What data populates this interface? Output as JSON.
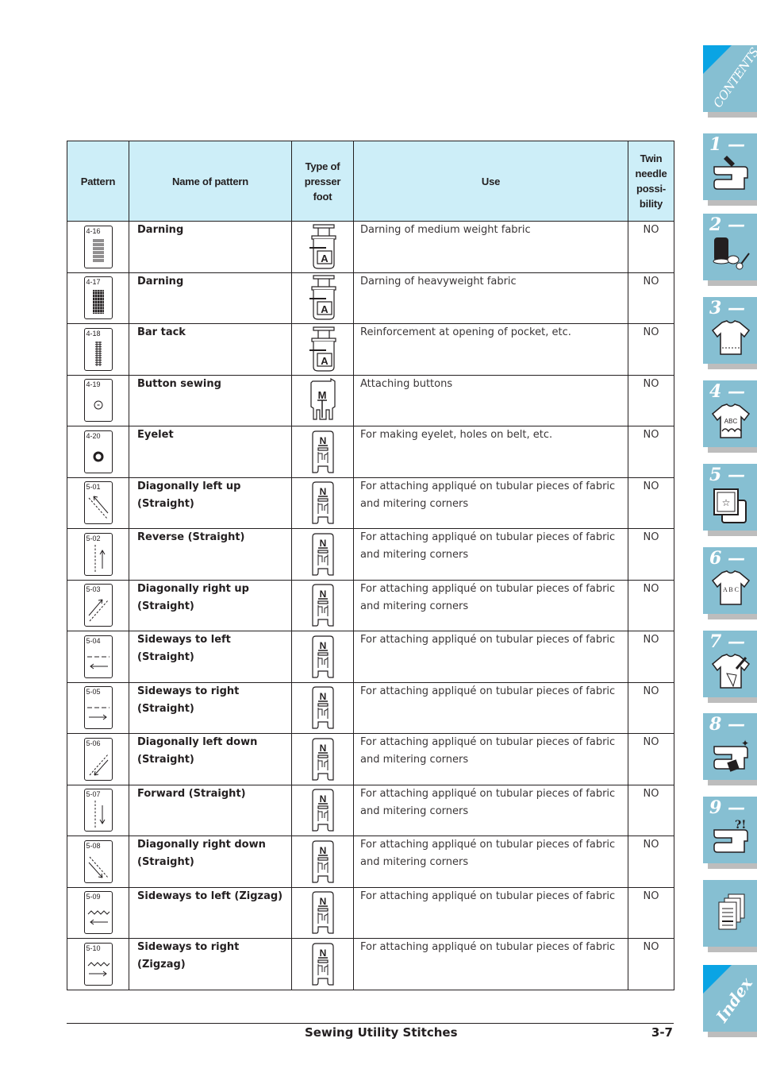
{
  "table": {
    "headers": {
      "pattern": "Pattern",
      "name": "Name of pattern",
      "foot": "Type of presser foot",
      "use": "Use",
      "twin": "Twin needle possi-bility"
    },
    "rows": [
      {
        "code": "4-16",
        "glyph": "darning-fine",
        "name": "Darning",
        "foot": "A",
        "use": "Darning of medium weight fabric",
        "twin": "NO"
      },
      {
        "code": "4-17",
        "glyph": "darning-dense",
        "name": "Darning",
        "foot": "A",
        "use": "Darning of heavyweight fabric",
        "twin": "NO"
      },
      {
        "code": "4-18",
        "glyph": "bar-tack",
        "name": "Bar tack",
        "foot": "A",
        "use": "Reinforcement at opening of pocket, etc.",
        "twin": "NO"
      },
      {
        "code": "4-19",
        "glyph": "button",
        "name": "Button sewing",
        "foot": "M",
        "use": "Attaching buttons",
        "twin": "NO"
      },
      {
        "code": "4-20",
        "glyph": "eyelet",
        "name": "Eyelet",
        "foot": "N",
        "use": "For making eyelet, holes on belt, etc.",
        "twin": "NO"
      },
      {
        "code": "5-01",
        "glyph": "diag-left-up",
        "name": "Diagonally left up (Straight)",
        "foot": "N",
        "use": "For attaching appliqué on tubular pieces of fabric and mitering corners",
        "twin": "NO"
      },
      {
        "code": "5-02",
        "glyph": "reverse",
        "name": "Reverse (Straight)",
        "foot": "N",
        "use": "For attaching appliqué on tubular pieces of fabric and mitering corners",
        "twin": "NO"
      },
      {
        "code": "5-03",
        "glyph": "diag-right-up",
        "name": "Diagonally right up (Straight)",
        "foot": "N",
        "use": "For attaching appliqué on tubular pieces of fabric and mitering corners",
        "twin": "NO"
      },
      {
        "code": "5-04",
        "glyph": "side-left",
        "name": "Sideways to left (Straight)",
        "foot": "N",
        "use": "For attaching appliqué on tubular pieces of fabric",
        "twin": "NO"
      },
      {
        "code": "5-05",
        "glyph": "side-right",
        "name": "Sideways to right (Straight)",
        "foot": "N",
        "use": "For attaching appliqué on tubular pieces of fabric",
        "twin": "NO"
      },
      {
        "code": "5-06",
        "glyph": "diag-left-down",
        "name": "Diagonally left down (Straight)",
        "foot": "N",
        "use": "For attaching appliqué on tubular pieces of fabric and mitering corners",
        "twin": "NO"
      },
      {
        "code": "5-07",
        "glyph": "forward",
        "name": "Forward (Straight)",
        "foot": "N",
        "use": "For attaching appliqué on tubular pieces of fabric and mitering corners",
        "twin": "NO"
      },
      {
        "code": "5-08",
        "glyph": "diag-right-down",
        "name": "Diagonally right down (Straight)",
        "foot": "N",
        "use": "For attaching appliqué on tubular pieces of fabric and mitering corners",
        "twin": "NO"
      },
      {
        "code": "5-09",
        "glyph": "zigzag-left",
        "name": "Sideways to left (Zigzag)",
        "foot": "N",
        "use": "For attaching appliqué on tubular pieces of fabric",
        "twin": "NO"
      },
      {
        "code": "5-10",
        "glyph": "zigzag-right",
        "name": "Sideways to right (Zigzag)",
        "foot": "N",
        "use": "For attaching appliqué on tubular pieces of fabric",
        "twin": "NO"
      }
    ]
  },
  "footer": {
    "section_title": "Sewing Utility Stitches",
    "page_number": "3-7"
  },
  "side_tabs": [
    {
      "label": "CONTENTS",
      "icon": "contents-icon"
    },
    {
      "label": "1 —",
      "icon": "sewing-machine-hand-icon"
    },
    {
      "label": "2 —",
      "icon": "thread-spool-scissors-icon"
    },
    {
      "label": "3 —",
      "icon": "shirt-stitch-icon"
    },
    {
      "label": "4 —",
      "icon": "shirt-embroidery-icon"
    },
    {
      "label": "5 —",
      "icon": "embroidery-frame-icon"
    },
    {
      "label": "6 —",
      "icon": "shirt-letters-icon"
    },
    {
      "label": "7 —",
      "icon": "shirt-pen-icon"
    },
    {
      "label": "8 —",
      "icon": "sewing-machine-clean-icon"
    },
    {
      "label": "9 —",
      "icon": "sewing-machine-trouble-icon"
    },
    {
      "label": "",
      "icon": "documents-icon"
    },
    {
      "label": "Index",
      "icon": "index-icon"
    }
  ],
  "colors": {
    "header_bg": "#cdeef8",
    "tab_bg": "#86bfd2",
    "tab_corner": "#0aa4e4",
    "tab_shadow": "#bdbdbd"
  }
}
